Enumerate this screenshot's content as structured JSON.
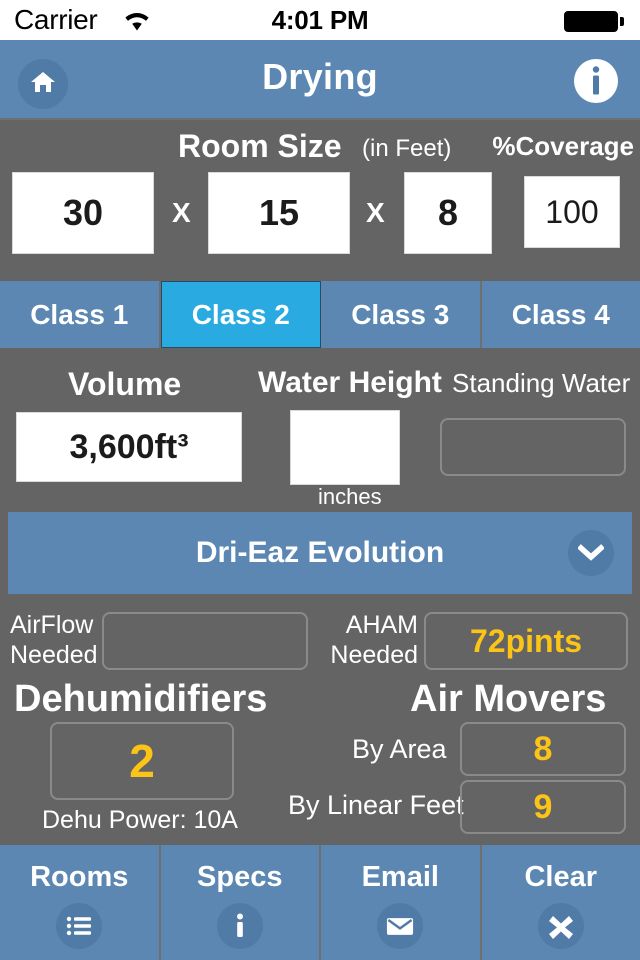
{
  "statusbar": {
    "carrier": "Carrier",
    "wifi_icon": "wifi-icon",
    "time": "4:01 PM",
    "battery_icon": "battery-full-icon"
  },
  "navbar": {
    "title": "Drying",
    "home_icon": "home-icon",
    "info_icon": "info-icon"
  },
  "room_size": {
    "title": "Room Size",
    "units_note": "(in Feet)",
    "coverage_label": "%Coverage",
    "length": "30",
    "width": "15",
    "height": "8",
    "coverage": "100",
    "multiply_1": "X",
    "multiply_2": "X"
  },
  "classes": {
    "tabs": [
      {
        "label": "Class 1",
        "active": false
      },
      {
        "label": "Class 2",
        "active": true
      },
      {
        "label": "Class 3",
        "active": false
      },
      {
        "label": "Class 4",
        "active": false
      }
    ]
  },
  "volume_section": {
    "volume_label": "Volume",
    "volume_value": "3,600ft³",
    "water_height_label": "Water Height",
    "water_height_value": "",
    "inches_label": "inches",
    "standing_water_label": "Standing Water",
    "standing_water_value": ""
  },
  "equipment_select": {
    "selected": "Dri-Eaz Evolution",
    "chevron_icon": "chevron-down-icon"
  },
  "needs": {
    "airflow_label": "AirFlow\nNeeded",
    "airflow_label_line1": "AirFlow",
    "airflow_label_line2": "Needed",
    "airflow_value": "",
    "aham_label_line1": "AHAM",
    "aham_label_line2": "Needed",
    "aham_value": "72pints"
  },
  "results": {
    "dehumidifiers_title": "Dehumidifiers",
    "dehumidifiers_value": "2",
    "dehu_power": "Dehu Power: 10A",
    "air_movers_title": "Air Movers",
    "by_area_label": "By Area",
    "by_area_value": "8",
    "by_linear_feet_label": "By Linear Feet",
    "by_linear_feet_value": "9"
  },
  "toolbar": {
    "items": [
      {
        "label": "Rooms",
        "icon": "list-icon"
      },
      {
        "label": "Specs",
        "icon": "info-icon"
      },
      {
        "label": "Email",
        "icon": "envelope-icon"
      },
      {
        "label": "Clear",
        "icon": "close-x-icon"
      }
    ]
  },
  "colors": {
    "background": "#646464",
    "bar_blue": "#5b87b2",
    "active_tab": "#29abe2",
    "value_yellow": "#fcc417",
    "icon_circle": "#4f7ba6"
  }
}
